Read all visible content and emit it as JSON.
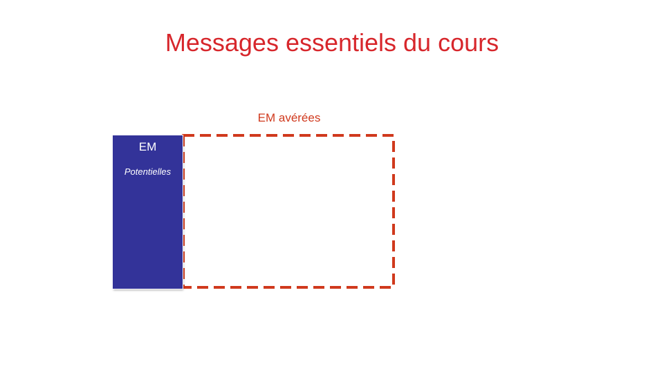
{
  "slide": {
    "title": "Messages essentiels du cours",
    "box_label": "EM avérées",
    "em_block": {
      "title": "EM",
      "subtitle": "Potentielles"
    }
  },
  "colors": {
    "title": "#d7262b",
    "box_label": "#d0391d",
    "dashed_border": "#d0391d",
    "em_block_fill": "#333399",
    "em_block_text": "#ffffff"
  }
}
